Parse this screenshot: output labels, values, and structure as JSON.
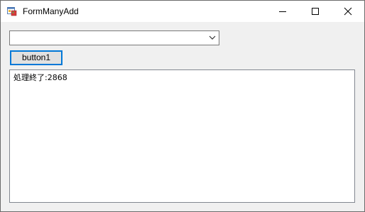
{
  "window": {
    "title": "FormManyAdd",
    "icon": "winforms-app-icon",
    "controls": {
      "minimize": "minimize-icon",
      "maximize": "maximize-icon",
      "close": "close-icon"
    }
  },
  "form": {
    "combo": {
      "value": "",
      "arrow_icon": "chevron-down-icon"
    },
    "button1_label": "button1",
    "output_text": "処理終了:2868"
  },
  "colors": {
    "form_background": "#f0f0f0",
    "focus_border": "#0078d7",
    "button_face": "#e1e1e1"
  }
}
